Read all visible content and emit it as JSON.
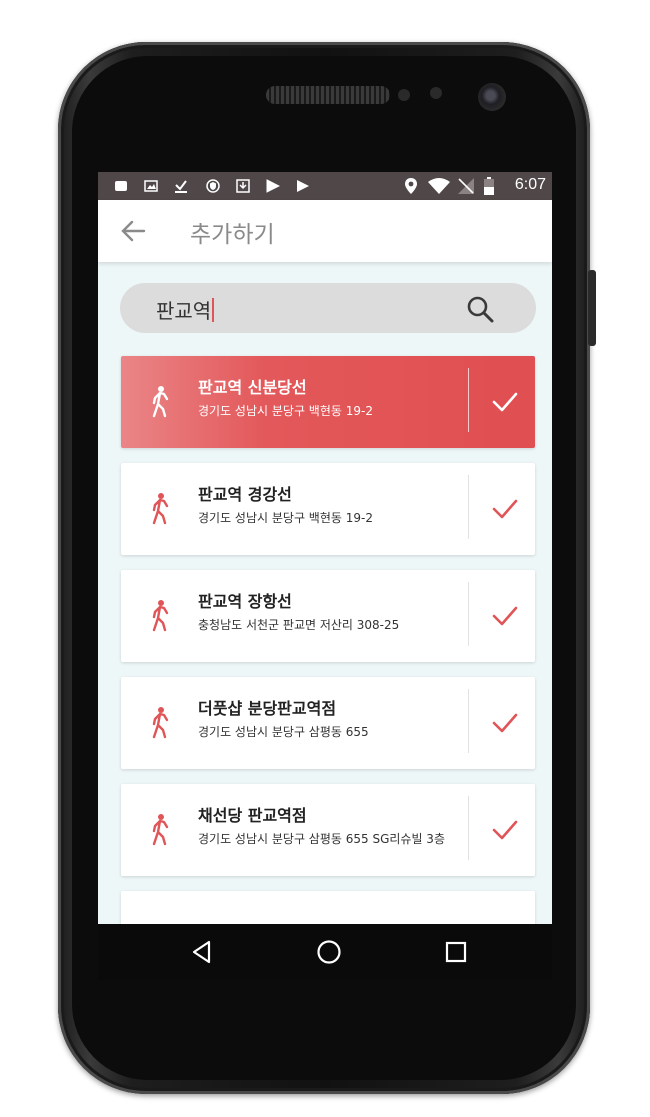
{
  "status_bar": {
    "time": "6:07",
    "left_icons": [
      "message-icon",
      "image-icon",
      "download-done-icon",
      "shield-icon",
      "download-icon",
      "flag-icon",
      "flag-icon"
    ],
    "right_icons": [
      "location-icon",
      "wifi-icon",
      "no-signal-icon",
      "battery-icon"
    ]
  },
  "app_bar": {
    "title": "추가하기"
  },
  "search": {
    "value": "판교역"
  },
  "results": [
    {
      "name": "판교역 신분당선",
      "address": "경기도 성남시 분당구 백현동 19-2",
      "selected": true
    },
    {
      "name": "판교역 경강선",
      "address": "경기도 성남시 분당구 백현동 19-2",
      "selected": false
    },
    {
      "name": "판교역 장항선",
      "address": "충청남도 서천군 판교면 저산리 308-25",
      "selected": false
    },
    {
      "name": "더풋샵 분당판교역점",
      "address": "경기도 성남시 분당구 삼평동 655",
      "selected": false
    },
    {
      "name": "채선당 판교역점",
      "address": "경기도 성남시 분당구 삼평동 655 SG리슈빌 3층",
      "selected": false
    }
  ],
  "colors": {
    "accent": "#e05557",
    "status_bar": "#4f4748",
    "screen_bg": "#eef7f8",
    "search_bg": "#dcdcdc"
  }
}
